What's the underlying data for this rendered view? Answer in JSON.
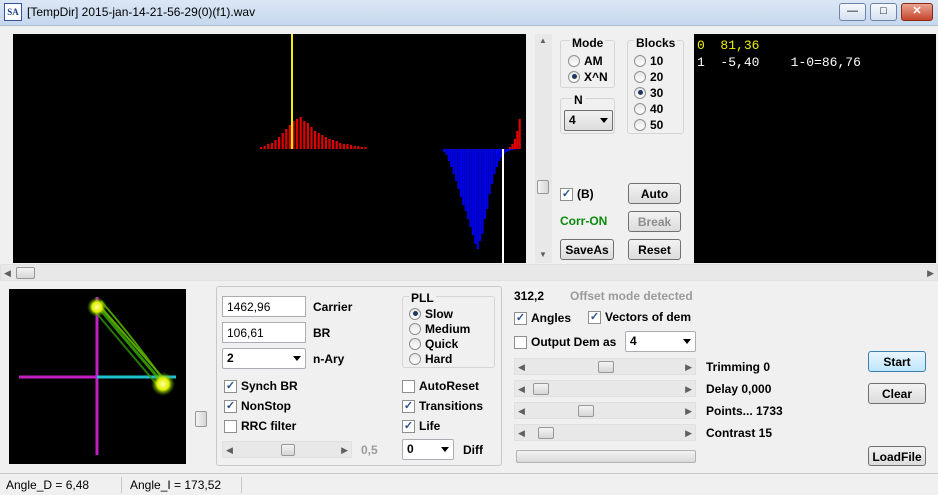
{
  "window": {
    "title": "[TempDir] 2015-jan-14-21-56-29(0)(f1).wav",
    "icon_text": "SA",
    "min": "—",
    "max": "□",
    "close": "✕"
  },
  "spectrum": {
    "red": [
      2,
      3,
      5,
      6,
      9,
      12,
      16,
      20,
      24,
      28,
      30,
      32,
      28,
      26,
      22,
      18,
      16,
      14,
      12,
      10,
      9,
      8,
      6,
      5,
      5,
      4,
      3,
      3,
      2,
      2
    ],
    "blue": [
      3,
      6,
      12,
      18,
      25,
      32,
      40,
      48,
      56,
      62,
      70,
      78,
      86,
      95,
      100,
      92,
      85,
      70,
      60,
      45,
      35,
      25,
      18,
      12,
      8,
      5,
      3,
      2,
      1,
      1
    ],
    "side": [
      2,
      5,
      10,
      18,
      30
    ]
  },
  "mode": {
    "label": "Mode",
    "opt_am": "AM",
    "opt_xn": "X^N"
  },
  "blocks": {
    "label": "Blocks",
    "o10": "10",
    "o20": "20",
    "o30": "30",
    "o40": "40",
    "o50": "50"
  },
  "n": {
    "label": "N",
    "value": "4"
  },
  "b_check": "(B)",
  "corr": "Corr-ON",
  "buttons": {
    "auto": "Auto",
    "break": "Break",
    "saveas": "SaveAs",
    "reset": "Reset",
    "start": "Start",
    "clear": "Clear",
    "loadfile": "LoadFile"
  },
  "readout": {
    "r0_idx": "0",
    "r0_val": "81,36",
    "r1_idx": "1",
    "r1_val": "-5,40",
    "r1_diff": "1-0=86,76"
  },
  "params": {
    "carrier_value": "1462,96",
    "carrier_label": "Carrier",
    "br_value": "106,61",
    "br_label": "BR",
    "nary_value": "2",
    "nary_label": "n-Ary"
  },
  "pll": {
    "label": "PLL",
    "slow": "Slow",
    "medium": "Medium",
    "quick": "Quick",
    "hard": "Hard"
  },
  "checks": {
    "synch": "Synch BR",
    "nonstop": "NonStop",
    "rrc": "RRC filter",
    "autoreset": "AutoReset",
    "transitions": "Transitions",
    "life": "Life"
  },
  "slider_value": "0,5",
  "diff": {
    "value": "0",
    "label": "Diff"
  },
  "offset": {
    "value": "312,2",
    "text": "Offset mode detected"
  },
  "right_checks": {
    "angles": "Angles",
    "vectors": "Vectors of dem",
    "output": "Output Dem as",
    "output_value": "4"
  },
  "sliders": {
    "trimming": "Trimming 0",
    "delay": "Delay  0,000",
    "points": "Points... 1733",
    "contrast": "Contrast 15"
  },
  "statusbar": {
    "angle_d": "Angle_D = 6,48",
    "angle_i": "Angle_I = 173,52"
  },
  "colors": {
    "yellow": "#f0f000",
    "red": "#e00000",
    "blue": "#0000e6",
    "magenta": "#c020c0",
    "cyan": "#20c0d0"
  }
}
